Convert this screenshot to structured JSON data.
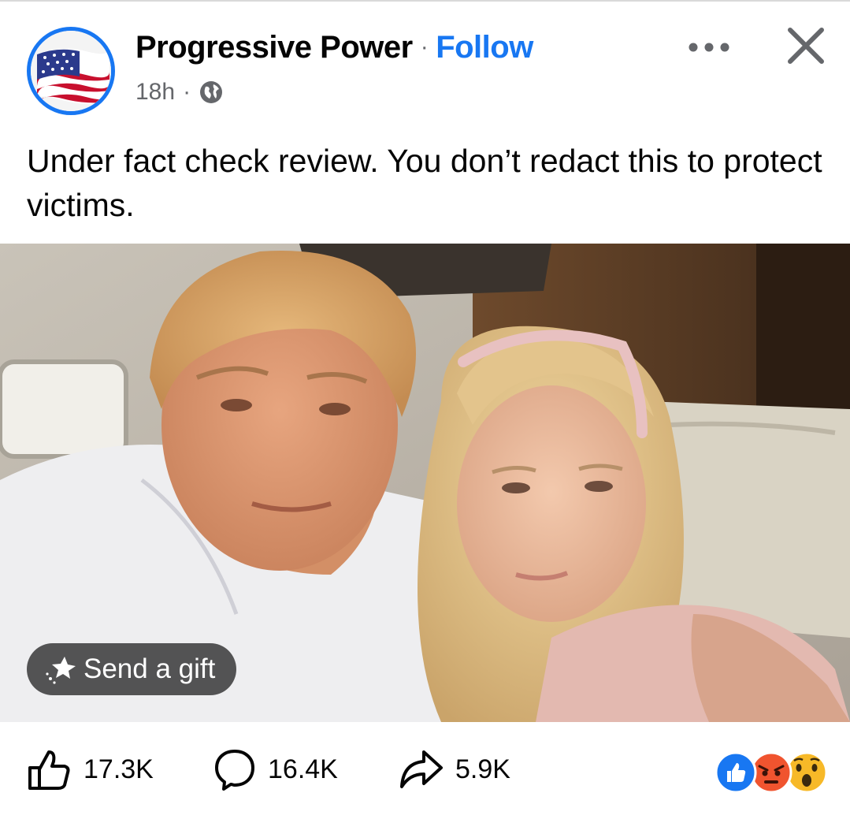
{
  "post": {
    "page_name": "Progressive Power",
    "separator": "·",
    "follow_label": "Follow",
    "time": "18h",
    "meta_separator": "·",
    "privacy_icon": "globe-icon",
    "caption": "Under fact check review. You don’t redact this to protect victims.",
    "gift_label": "Send a gift"
  },
  "footer": {
    "likes": "17.3K",
    "comments": "16.4K",
    "shares": "5.9K",
    "reactions": [
      "like",
      "angry",
      "wow"
    ]
  },
  "colors": {
    "accent": "#1877f2",
    "secondary_text": "#65676b",
    "angry": "#f0542f",
    "wow": "#f7b928"
  }
}
